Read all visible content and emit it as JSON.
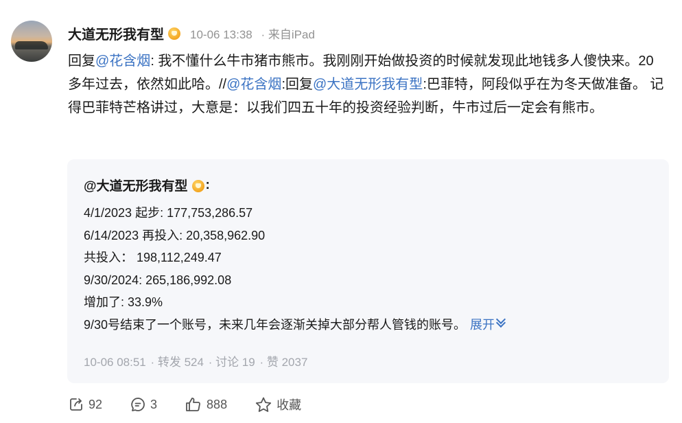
{
  "post": {
    "author": "大道无形我有型",
    "time": "10-06 13:38",
    "source": "· 来自iPad",
    "content": [
      {
        "t": "text",
        "v": "回复"
      },
      {
        "t": "link",
        "v": "@花含烟"
      },
      {
        "t": "text",
        "v": ": 我不懂什么牛市猪市熊市。我刚刚开始做投资的时候就发现此地钱多人傻快来。20多年过去，依然如此哈。//"
      },
      {
        "t": "link",
        "v": "@花含烟"
      },
      {
        "t": "text",
        "v": ":回复"
      },
      {
        "t": "link",
        "v": "@大道无形我有型"
      },
      {
        "t": "text",
        "v": ":巴菲特，阿段似乎在为冬天做准备。 记得巴菲特芒格讲过，大意是：以我们四五十年的投资经验判断，牛市过后一定会有熊市。"
      }
    ]
  },
  "quoted": {
    "author": "@大道无形我有型",
    "author_suffix": ":",
    "lines": [
      "4/1/2023 起步: 177,753,286.57",
      "6/14/2023 再投入: 20,358,962.90",
      "共投入： 198,112,249.47",
      "9/30/2024: 265,186,992.08",
      "增加了: 33.9%",
      "9/30号结束了一个账号，未来几年会逐渐关掉大部分帮人管钱的账号。"
    ],
    "expand_label": "展开",
    "time": "10-06 08:51",
    "repost": "· 转发 524",
    "comment": "· 讨论 19",
    "like": "· 赞 2037"
  },
  "actions": {
    "share_count": "92",
    "comment_count": "3",
    "like_count": "888",
    "favorite_label": "收藏"
  },
  "colors": {
    "link": "#3b73c3",
    "meta": "#939393",
    "quote_bg": "#f6f7fa"
  }
}
